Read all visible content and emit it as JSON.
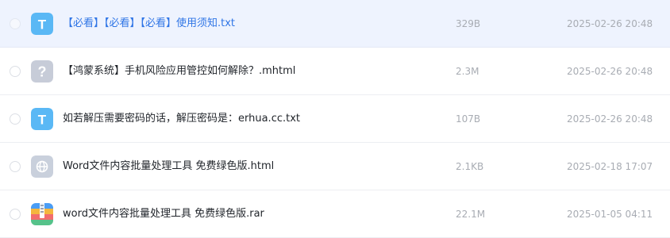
{
  "files": [
    {
      "name": "【必看】【必看】【必看】使用须知.txt",
      "size": "329B",
      "date": "2025-02-26 20:48",
      "icon": "text-file-icon"
    },
    {
      "name": "【鸿蒙系统】手机风险应用管控如何解除？.mhtml",
      "size": "2.3M",
      "date": "2025-02-26 20:48",
      "icon": "unknown-file-icon"
    },
    {
      "name": "如若解压需要密码的话，解压密码是：erhua.cc.txt",
      "size": "107B",
      "date": "2025-02-26 20:48",
      "icon": "text-file-icon"
    },
    {
      "name": "Word文件内容批量处理工具 免费绿色版.html",
      "size": "2.1KB",
      "date": "2025-02-18 17:07",
      "icon": "web-file-icon"
    },
    {
      "name": "word文件内容批量处理工具 免费绿色版.rar",
      "size": "22.1M",
      "date": "2025-01-05 04:11",
      "icon": "archive-file-icon"
    }
  ],
  "colors": {
    "hover_row_bg": "#eef3fe",
    "hover_text": "#2f75e6",
    "text_icon": "#5ab8f5",
    "unknown_icon": "#c7ccd8",
    "web_icon": "#c9d0dc"
  }
}
